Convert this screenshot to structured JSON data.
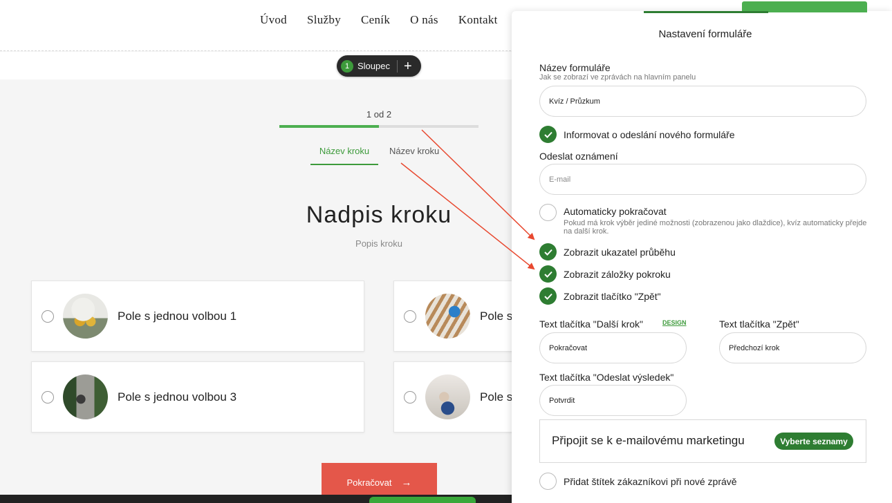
{
  "site": {
    "nav": [
      "Úvod",
      "Služby",
      "Ceník",
      "O nás",
      "Kontakt"
    ],
    "column_toolbar": {
      "count": "1",
      "label": "Sloupec",
      "add": "+"
    },
    "progress": {
      "text": "1 od  2",
      "fraction": 0.5
    },
    "tabs": [
      "Název kroku",
      "Název kroku"
    ],
    "step_title": "Nadpis kroku",
    "step_description": "Popis kroku",
    "choices": [
      "Pole s jednou volbou 1",
      "Pole s",
      "Pole s jednou volbou 3",
      "Pole s"
    ],
    "continue_label": "Pokračovat",
    "continue_icon": "arrow-right-icon",
    "arrow_color": "#e8482f"
  },
  "panel": {
    "title": "Nastavení formuláře",
    "form_name": {
      "label": "Název formuláře",
      "hint": "Jak se zobrazí ve zprávách na hlavním panelu",
      "value": "Kvíz / Průzkum"
    },
    "notify": {
      "label": "Informovat o odeslání nového formuláře",
      "checked": true
    },
    "send_notification": {
      "label": "Odeslat oznámení",
      "placeholder": "E-mail"
    },
    "auto_continue": {
      "label": "Automaticky pokračovat",
      "hint_line1": "Pokud má krok výběr jediné možnosti (zobrazenou jako dlaždice), kvíz automaticky přejde",
      "hint_line2": "na další krok.",
      "checked": false
    },
    "show_progress": {
      "label": "Zobrazit ukazatel průběhu",
      "checked": true
    },
    "show_tabs": {
      "label": "Zobrazit záložky pokroku",
      "checked": true
    },
    "show_back": {
      "label": "Zobrazit tlačítko \"Zpět\"",
      "checked": true
    },
    "next_button": {
      "label": "Text tlačítka \"Další krok\"",
      "value": "Pokračovat",
      "design": "DESIGN"
    },
    "back_button": {
      "label": "Text tlačítka \"Zpět\"",
      "value": "Předchozí krok"
    },
    "submit_button": {
      "label": "Text tlačítka \"Odeslat výsledek\"",
      "value": "Potvrdit"
    },
    "marketing": {
      "title": "Připojit se k e-mailovému marketingu",
      "button": "Vyberte seznamy"
    },
    "add_tag": {
      "label": "Přidat štítek zákazníkovi při nové zprávě",
      "checked": false
    },
    "accent_color": "#2e7d32"
  }
}
